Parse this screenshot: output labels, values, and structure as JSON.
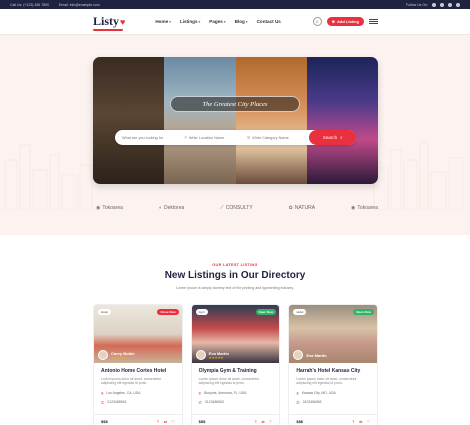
{
  "topbar": {
    "phone": "Call Us: (+123) 456 7890",
    "email": "Email: info@example.com",
    "follow": "Follow Us On:",
    "social_icons": [
      "facebook-icon",
      "twitter-icon",
      "instagram-icon",
      "linkedin-icon"
    ]
  },
  "header": {
    "logo": "Listy",
    "nav": [
      "Home",
      "Listings",
      "Pages",
      "Blog",
      "Contact Us"
    ],
    "add_listing": "Add Listing"
  },
  "hero": {
    "title": "The Greatest City Places",
    "search": {
      "keyword_placeholder": "What are you looking for",
      "location_placeholder": "Write Location Name",
      "category_placeholder": "Write Category Name",
      "button": "Search"
    }
  },
  "brands": [
    "Tokoarea",
    "Dektorea",
    "CONSULTY",
    "NATURA",
    "Tokoarea"
  ],
  "listings": {
    "kicker": "OUR LATEST LISTING",
    "title": "New Listings in Our Directory",
    "subtitle": "Lorem Ipsum is simply dummy text of the printing and typesetting industry.",
    "cards": [
      {
        "tag": "Hotel",
        "status": "Close Now",
        "status_color": "#e8303f",
        "owner": "Carey Butler",
        "rating": "★★★★★",
        "title": "Antonio Home Cortes Hotel",
        "desc": "Lorem ipsum dolor sit amet, consectetur adipiscing elit egestas id proin.",
        "location": "Los Angeles, CA, USA",
        "phone": "0123456963",
        "price": "$$$"
      },
      {
        "tag": "Gym",
        "status": "Open Now",
        "status_color": "#2fb36a",
        "owner": "Eva Martin",
        "rating": "★★★★★",
        "title": "Olympia Gym & Training",
        "desc": "Lorem ipsum dolor sit amet, consectetur adipiscing elit egestas id proin.",
        "location": "Bonjorie, Aventura, FL, USA",
        "phone": "0123456963",
        "price": "$$$"
      },
      {
        "tag": "Hotel",
        "status": "Open Now",
        "status_color": "#2fb36a",
        "owner": "Eva Martin",
        "rating": "",
        "title": "Harrah's Hotel Kansas City",
        "desc": "Lorem ipsum dolor sit amet, consectetur adipiscing elit egestas id proin.",
        "location": "Kansas City, MO, USA",
        "phone": "0123456963",
        "price": "$$$"
      }
    ]
  },
  "colors": {
    "accent": "#e8303f",
    "navy": "#1f2340",
    "hero_bg": "#fcf2f0",
    "open": "#2fb36a"
  }
}
